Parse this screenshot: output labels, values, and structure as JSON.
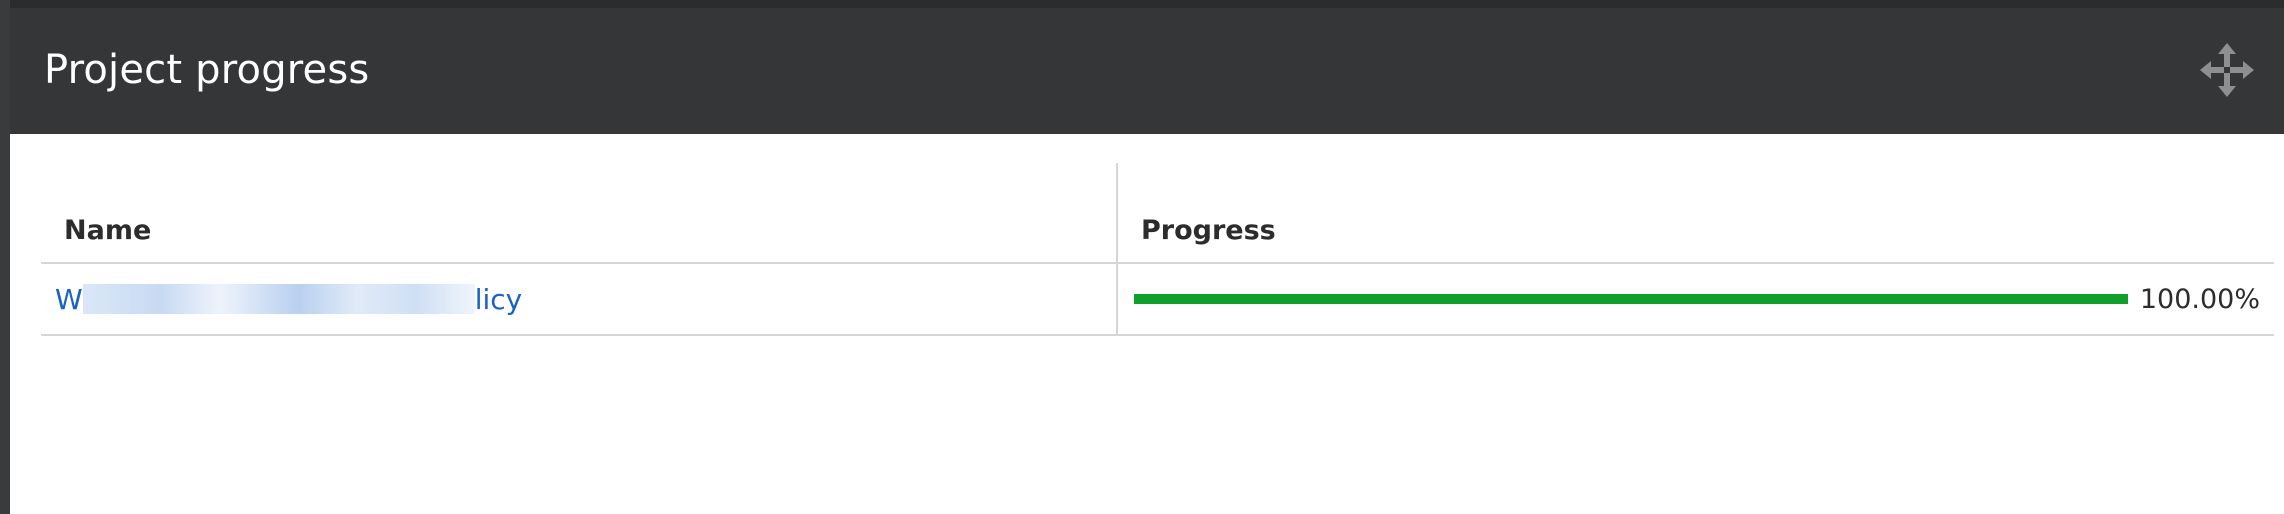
{
  "panel": {
    "title": "Project progress",
    "move_icon": "move-arrows-icon"
  },
  "table": {
    "headers": {
      "name": "Name",
      "progress": "Progress"
    },
    "rows": [
      {
        "name_start": "W",
        "name_end": "licy",
        "progress_fraction": 1.0,
        "progress_label": "100.00%"
      }
    ]
  },
  "colors": {
    "header_bg": "#353638",
    "link": "#1a63c4",
    "progress_fill": "#109e2c"
  }
}
